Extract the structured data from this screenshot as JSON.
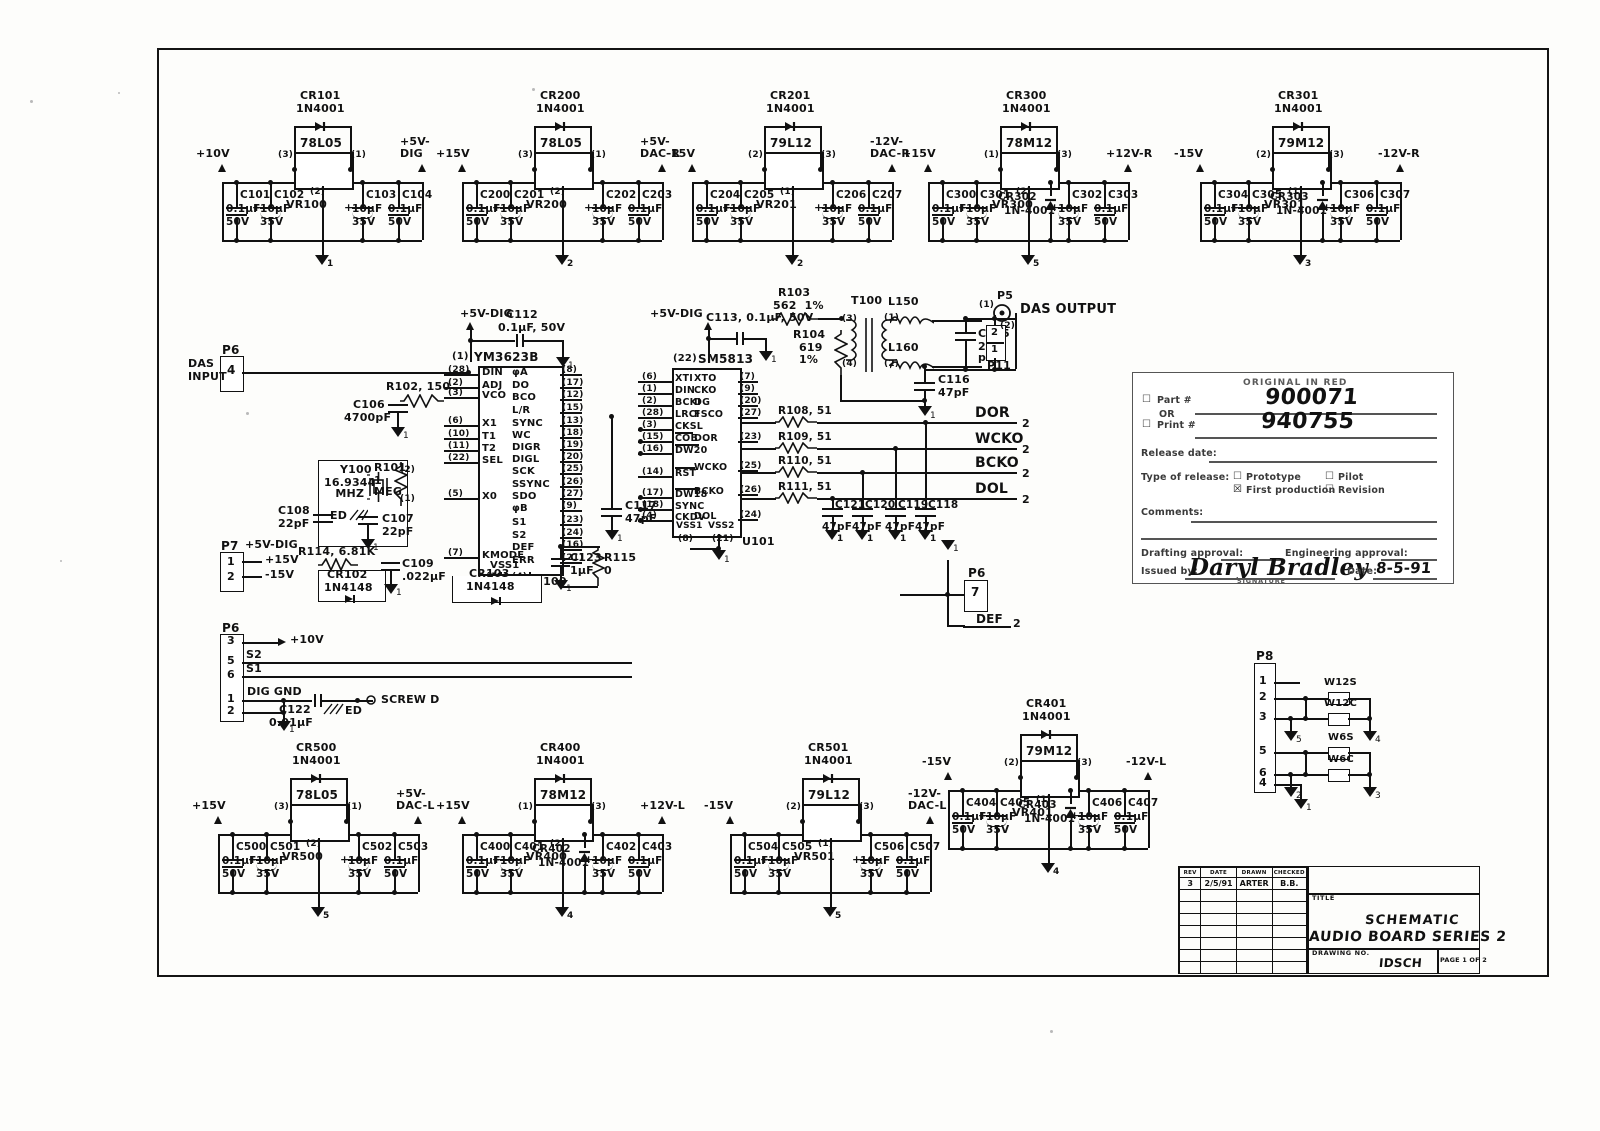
{
  "document": {
    "kind": "hand-drawn electronic schematic",
    "sheet_title": "SCHEMATIC",
    "title_line2": "AUDIO BOARD SERIES 2",
    "drawing_no_label": "DRAWING NO.",
    "drawing_no": "IDSCH",
    "page": "PAGE 1 OF 2",
    "title_label": "TITLE"
  },
  "approval_block": {
    "header": "ORIGINAL IN RED",
    "part_label": "Part #",
    "part_value": "900071",
    "or_label": "OR",
    "print_label": "Print #",
    "print_value": "940755",
    "release_date_label": "Release date:",
    "type_label": "Type of release:",
    "type_options": [
      "Prototype",
      "Pilot",
      "First production",
      "Revision"
    ],
    "comments_label": "Comments:",
    "drafting_label": "Drafting approval:",
    "engineering_label": "Engineering approval:",
    "issued_label": "Issued by:",
    "issued_signature": "Daryl Bradley",
    "signature_caption": "SIGNATURE",
    "date_label": "Date:",
    "date_value": "8-5-91"
  },
  "revision_block": {
    "columns": [
      "REV",
      "DATE",
      "DRAWN",
      "CHECKED"
    ],
    "rows": [
      [
        "3",
        "2/5/91",
        "ARTER",
        "B.B."
      ],
      [
        "",
        "",
        "",
        ""
      ],
      [
        "",
        "",
        "",
        ""
      ],
      [
        "",
        "",
        "",
        ""
      ],
      [
        "",
        "",
        "",
        ""
      ],
      [
        "",
        "",
        "",
        ""
      ],
      [
        "",
        "",
        "",
        ""
      ],
      [
        "",
        "",
        "",
        ""
      ]
    ]
  },
  "regulators_top": [
    {
      "id": "reg-1",
      "input_rail": "+10V",
      "output_rail": "+5V-\nDIG",
      "diode_ref": "CR101",
      "diode_type": "1N4001",
      "device": "78L05",
      "device_ref": "VR100",
      "pins": [
        "(3)",
        "(1)",
        "(2)"
      ],
      "gnd_num": "1",
      "caps": [
        {
          "ref": "C101",
          "val": "0.1µF",
          "volt": "50V",
          "polar": false
        },
        {
          "ref": "C102",
          "val": "10µF",
          "volt": "35V",
          "polar": true
        },
        {
          "ref": "C103",
          "val": "10µF",
          "volt": "35V",
          "polar": true
        },
        {
          "ref": "C104",
          "val": "0.1µF",
          "volt": "50V",
          "polar": false
        }
      ]
    },
    {
      "id": "reg-2",
      "input_rail": "+15V",
      "output_rail": "+5V-\nDAC-R",
      "diode_ref": "CR200",
      "diode_type": "1N4001",
      "device": "78L05",
      "device_ref": "VR200",
      "pins": [
        "(3)",
        "(1)",
        "(2)"
      ],
      "gnd_num": "2",
      "caps": [
        {
          "ref": "C200",
          "val": "0.1µF",
          "volt": "50V",
          "polar": false
        },
        {
          "ref": "C201",
          "val": "10µF",
          "volt": "35V",
          "polar": true
        },
        {
          "ref": "C202",
          "val": "10µF",
          "volt": "35V",
          "polar": true
        },
        {
          "ref": "C203",
          "val": "0.1µF",
          "volt": "50V",
          "polar": false
        }
      ]
    },
    {
      "id": "reg-3",
      "input_rail": "-15V",
      "output_rail": "-12V-\nDAC-R",
      "diode_ref": "CR201",
      "diode_type": "1N4001",
      "device": "79L12",
      "device_ref": "VR201",
      "pins": [
        "(2)",
        "(3)",
        "(1)"
      ],
      "gnd_num": "2",
      "caps": [
        {
          "ref": "C204",
          "val": "0.1µF",
          "volt": "50V",
          "polar": false
        },
        {
          "ref": "C205",
          "val": "10µF",
          "volt": "35V",
          "polar": true
        },
        {
          "ref": "C206",
          "val": "10µF",
          "volt": "35V",
          "polar": true
        },
        {
          "ref": "C207",
          "val": "0.1µF",
          "volt": "50V",
          "polar": false
        }
      ]
    },
    {
      "id": "reg-4",
      "input_rail": "+15V",
      "output_rail": "+12V-R",
      "diode_ref": "CR300",
      "diode_type": "1N4001",
      "device": "78M12",
      "device_ref": "VR300",
      "pins": [
        "(1)",
        "(3)",
        "(2)"
      ],
      "gnd_num": "5",
      "extra_diode": {
        "ref": "CR302",
        "type": "1N-4001"
      },
      "caps": [
        {
          "ref": "C300",
          "val": "0.1µF",
          "volt": "50V",
          "polar": false
        },
        {
          "ref": "C301",
          "val": "10µF",
          "volt": "35V",
          "polar": true
        },
        {
          "ref": "C302",
          "val": "10µF",
          "volt": "35V",
          "polar": true
        },
        {
          "ref": "C303",
          "val": "0.1µF",
          "volt": "50V",
          "polar": false
        }
      ]
    },
    {
      "id": "reg-5",
      "input_rail": "-15V",
      "output_rail": "-12V-R",
      "diode_ref": "CR301",
      "diode_type": "1N4001",
      "device": "79M12",
      "device_ref": "VR301",
      "pins": [
        "(2)",
        "(3)",
        "(1)"
      ],
      "gnd_num": "3",
      "extra_diode": {
        "ref": "CR303",
        "type": "1N-4001"
      },
      "caps": [
        {
          "ref": "C304",
          "val": "0.1µF",
          "volt": "50V",
          "polar": false
        },
        {
          "ref": "C305",
          "val": "10µF",
          "volt": "35V",
          "polar": true
        },
        {
          "ref": "C306",
          "val": "10µF",
          "volt": "35V",
          "polar": true
        },
        {
          "ref": "C307",
          "val": "0.1µF",
          "volt": "50V",
          "polar": false
        }
      ]
    }
  ],
  "regulators_bottom": [
    {
      "id": "reg-6",
      "input_rail": "+15V",
      "output_rail": "+5V-\nDAC-L",
      "diode_ref": "CR500",
      "diode_type": "1N4001",
      "device": "78L05",
      "device_ref": "VR500",
      "pins": [
        "(3)",
        "(1)",
        "(2)"
      ],
      "gnd_num": "5",
      "caps": [
        {
          "ref": "C500",
          "val": "0.1µF",
          "volt": "50V",
          "polar": false
        },
        {
          "ref": "C501",
          "val": "10µF",
          "volt": "35V",
          "polar": true
        },
        {
          "ref": "C502",
          "val": "10µF",
          "volt": "35V",
          "polar": true
        },
        {
          "ref": "C503",
          "val": "0.1µF",
          "volt": "50V",
          "polar": false
        }
      ]
    },
    {
      "id": "reg-7",
      "input_rail": "+15V",
      "output_rail": "+12V-L",
      "diode_ref": "CR400",
      "diode_type": "1N4001",
      "device": "78M12",
      "device_ref": "VR400",
      "pins": [
        "(1)",
        "(3)",
        "(2)"
      ],
      "gnd_num": "4",
      "extra_diode": {
        "ref": "CR402",
        "type": "1N-4001"
      },
      "caps": [
        {
          "ref": "C400",
          "val": "0.1µF",
          "volt": "50V",
          "polar": false
        },
        {
          "ref": "C401",
          "val": "10µF",
          "volt": "35V",
          "polar": true
        },
        {
          "ref": "C402",
          "val": "10µF",
          "volt": "35V",
          "polar": true
        },
        {
          "ref": "C403",
          "val": "0.1µF",
          "volt": "50V",
          "polar": false
        }
      ]
    },
    {
      "id": "reg-8",
      "input_rail": "-15V",
      "output_rail": "-12V-\nDAC-L",
      "diode_ref": "CR501",
      "diode_type": "1N4001",
      "device": "79L12",
      "device_ref": "VR501",
      "pins": [
        "(2)",
        "(3)",
        "(1)"
      ],
      "gnd_num": "5",
      "caps": [
        {
          "ref": "C504",
          "val": "0.1µF",
          "volt": "50V",
          "polar": false
        },
        {
          "ref": "C505",
          "val": "10µF",
          "volt": "35V",
          "polar": true
        },
        {
          "ref": "C506",
          "val": "10µF",
          "volt": "35V",
          "polar": true
        },
        {
          "ref": "C507",
          "val": "0.1µF",
          "volt": "50V",
          "polar": false
        }
      ]
    },
    {
      "id": "reg-9",
      "input_rail": "-15V",
      "output_rail": "-12V-L",
      "diode_ref": "CR401",
      "diode_type": "1N4001",
      "device": "79M12",
      "device_ref": "VR401",
      "pins": [
        "(2)",
        "(3)",
        "(1)"
      ],
      "gnd_num": "4",
      "extra_diode": {
        "ref": "CR403",
        "type": "1N-4001"
      },
      "caps": [
        {
          "ref": "C404",
          "val": "0.1µF",
          "volt": "50V",
          "polar": false
        },
        {
          "ref": "C405",
          "val": "10µF",
          "volt": "35V",
          "polar": true
        },
        {
          "ref": "C406",
          "val": "10µF",
          "volt": "35V",
          "polar": true
        },
        {
          "ref": "C407",
          "val": "0.1µF",
          "volt": "50V",
          "polar": false
        }
      ]
    }
  ],
  "u100": {
    "ref": "U100",
    "part": "YM3623B",
    "top_pin": "(1)",
    "rail": "+5V-DIG",
    "bypass_cap": "C112",
    "bypass_val": "0.1µF, 50V",
    "left_pins": [
      {
        "num": "(28)",
        "name": "DIN"
      },
      {
        "num": "(2)",
        "name": "ADJ"
      },
      {
        "num": "(3)",
        "name": "VCO"
      },
      {
        "num": "(6)",
        "name": "X1"
      },
      {
        "num": "(10)",
        "name": "T1"
      },
      {
        "num": "(11)",
        "name": "T2"
      },
      {
        "num": "(22)",
        "name": "SEL"
      },
      {
        "num": "(5)",
        "name": "X0"
      },
      {
        "num": "(7)",
        "name": "KMODE"
      }
    ],
    "right_pins": [
      {
        "num": "(8)",
        "name": "φA"
      },
      {
        "num": "(17)",
        "name": "DO"
      },
      {
        "num": "(12)",
        "name": "BCO"
      },
      {
        "num": "(15)",
        "name": "L/R"
      },
      {
        "num": "(13)",
        "name": "SYNC"
      },
      {
        "num": "(18)",
        "name": "WC"
      },
      {
        "num": "(19)",
        "name": "DIGR"
      },
      {
        "num": "(20)",
        "name": "DIGL"
      },
      {
        "num": "(25)",
        "name": "SCK"
      },
      {
        "num": "(26)",
        "name": "SSYNC"
      },
      {
        "num": "(27)",
        "name": "SDO"
      },
      {
        "num": "(9)",
        "name": "φB"
      },
      {
        "num": "(23)",
        "name": "S1"
      },
      {
        "num": "(24)",
        "name": "S2"
      },
      {
        "num": "(16)",
        "name": "DEF"
      },
      {
        "num": "(21)",
        "name": "ERR"
      }
    ],
    "gnd_pins": [
      {
        "num": "(19)",
        "name": "VSS1"
      },
      {
        "num": "(4)",
        "name": ""
      }
    ]
  },
  "u101": {
    "ref": "U101",
    "part": "SM5813",
    "top_pin": "(22)",
    "rail": "+5V-DIG",
    "bypass_cap": "C113, 0.1µF, 50V",
    "left_pins": [
      {
        "num": "(6)",
        "name": "XTI"
      },
      {
        "num": "(1)",
        "name": "DIN"
      },
      {
        "num": "(2)",
        "name": "BCKI"
      },
      {
        "num": "(28)",
        "name": "LRCI"
      },
      {
        "num": "(3)",
        "name": "CKSL"
      },
      {
        "num": "(15)",
        "name": "COB"
      },
      {
        "num": "(16)",
        "name": "DW20"
      },
      {
        "num": "(14)",
        "name": "RST"
      },
      {
        "num": "(17)",
        "name": "DW18"
      },
      {
        "num": "(18)",
        "name": "SYNC"
      },
      {
        "num": "(4)",
        "name": "CKDV"
      }
    ],
    "right_pins": [
      {
        "num": "(7)",
        "name": "XTO"
      },
      {
        "num": "(9)",
        "name": "CKO"
      },
      {
        "num": "(20)",
        "name": "DG"
      },
      {
        "num": "(27)",
        "name": "FSCO"
      },
      {
        "num": "(23)",
        "name": "DOR"
      },
      {
        "num": "(25)",
        "name": "WCKO"
      },
      {
        "num": "(26)",
        "name": "BCKO"
      },
      {
        "num": "(24)",
        "name": "DOL"
      }
    ],
    "gnd_pins": [
      {
        "num": "(8)",
        "name": "VSS1"
      },
      {
        "num": "(21)",
        "name": "VSS2"
      }
    ]
  },
  "output_signals": [
    {
      "resistor": "R108, 51",
      "name": "DOR",
      "sheet": "2",
      "cap": "C118",
      "cap_val": "47pF"
    },
    {
      "resistor": "R109, 51",
      "name": "WCKO",
      "sheet": "2",
      "cap": "C119",
      "cap_val": "47pF"
    },
    {
      "resistor": "R110, 51",
      "name": "BCKO",
      "sheet": "2",
      "cap": "C120",
      "cap_val": "47pF"
    },
    {
      "resistor": "R111, 51",
      "name": "DOL",
      "sheet": "2",
      "cap": "C121",
      "cap_val": "47pF"
    }
  ],
  "das_output_network": {
    "series_resistor": {
      "ref": "R103",
      "val": "562",
      "tol": "1%"
    },
    "shunt_resistor": {
      "ref": "R104",
      "val": "619",
      "tol": "1%"
    },
    "transformer": {
      "ref": "T100",
      "pri_pins": [
        "(3)",
        "(4)"
      ],
      "sec_pins": [
        "(1)",
        "(2)"
      ]
    },
    "inductors": [
      {
        "ref": "L150"
      },
      {
        "ref": "L160"
      }
    ],
    "caps": [
      {
        "ref": "C115",
        "val": "220\npF"
      },
      {
        "ref": "C116",
        "val": "47pF"
      }
    ],
    "jack": {
      "ref": "P5",
      "label": "DAS OUTPUT",
      "pins": [
        "(1)",
        "(2)"
      ]
    },
    "header": {
      "ref": "P11",
      "pins": [
        "2",
        "1"
      ]
    },
    "gnd_num": "1"
  },
  "clock": {
    "crystal_ref": "Y100",
    "crystal_freq": "16.9344\nMHZ",
    "shield_label": "ED",
    "resistor": {
      "ref": "R101",
      "val": "1\nMEG",
      "pins": [
        "(2)",
        "(1)"
      ]
    },
    "caps": [
      {
        "ref": "C108",
        "val": "22pF"
      },
      {
        "ref": "C107",
        "val": "22pF"
      }
    ]
  },
  "misc_parts": {
    "r102": "R102, 150",
    "c106": {
      "ref": "C106",
      "val": "4700pF"
    },
    "r114": "R114, 6.81K",
    "cr102": {
      "ref": "CR102",
      "type": "1N4148"
    },
    "cr103": {
      "ref": "CR103",
      "type": "1N4148"
    },
    "c109": {
      "ref": "C109",
      "val": ".022µF"
    },
    "c117": {
      "ref": "C117",
      "val": "47pF"
    },
    "c123": {
      "ref": "C123",
      "val": "1µF"
    },
    "r115": {
      "ref": "R115",
      "val": "0"
    },
    "c122": {
      "ref": "C122",
      "val": "0.01µF"
    },
    "screw_label": "SCREW D",
    "ed_label": "ED",
    "dig_gnd": "DIG GND"
  },
  "connectors": {
    "p6_input": {
      "ref": "P6",
      "label": "DAS\nINPUT",
      "pin": "4"
    },
    "p7": {
      "ref": "P7",
      "rail": "+5V-DIG",
      "pins": [
        {
          "num": "1",
          "signal": "+15V"
        },
        {
          "num": "2",
          "signal": "-15V"
        }
      ]
    },
    "p6_power": {
      "ref": "P6",
      "pins": [
        {
          "num": "3",
          "signal": "+10V"
        },
        {
          "num": "5",
          "signal": "S2"
        },
        {
          "num": "6",
          "signal": "S1"
        },
        {
          "num": "1",
          "signal": "DIG GND"
        },
        {
          "num": "2",
          "signal": ""
        }
      ],
      "gnd_num": "1"
    },
    "p6_def": {
      "ref": "P6",
      "pin": "7",
      "signal": "DEF",
      "sheet": "2"
    },
    "p8": {
      "ref": "P8",
      "pins": [
        "1",
        "2",
        "3",
        "5",
        "6",
        "4"
      ],
      "jumpers": [
        "W12S",
        "W12C",
        "W6S",
        "W6C"
      ],
      "gnd_nums": [
        "5",
        "4",
        "2",
        "3",
        "1"
      ]
    }
  },
  "rail_names": [
    "+10V",
    "+15V",
    "-15V",
    "+5V-DIG",
    "+5V-DAC-R",
    "-12V-DAC-R",
    "+12V-R",
    "-12V-R",
    "+5V-DAC-L",
    "+12V-L",
    "-12V-L",
    "-12V-DAC-L"
  ],
  "colors": {
    "ink": "#111111",
    "paper": "#fdfdfb"
  }
}
